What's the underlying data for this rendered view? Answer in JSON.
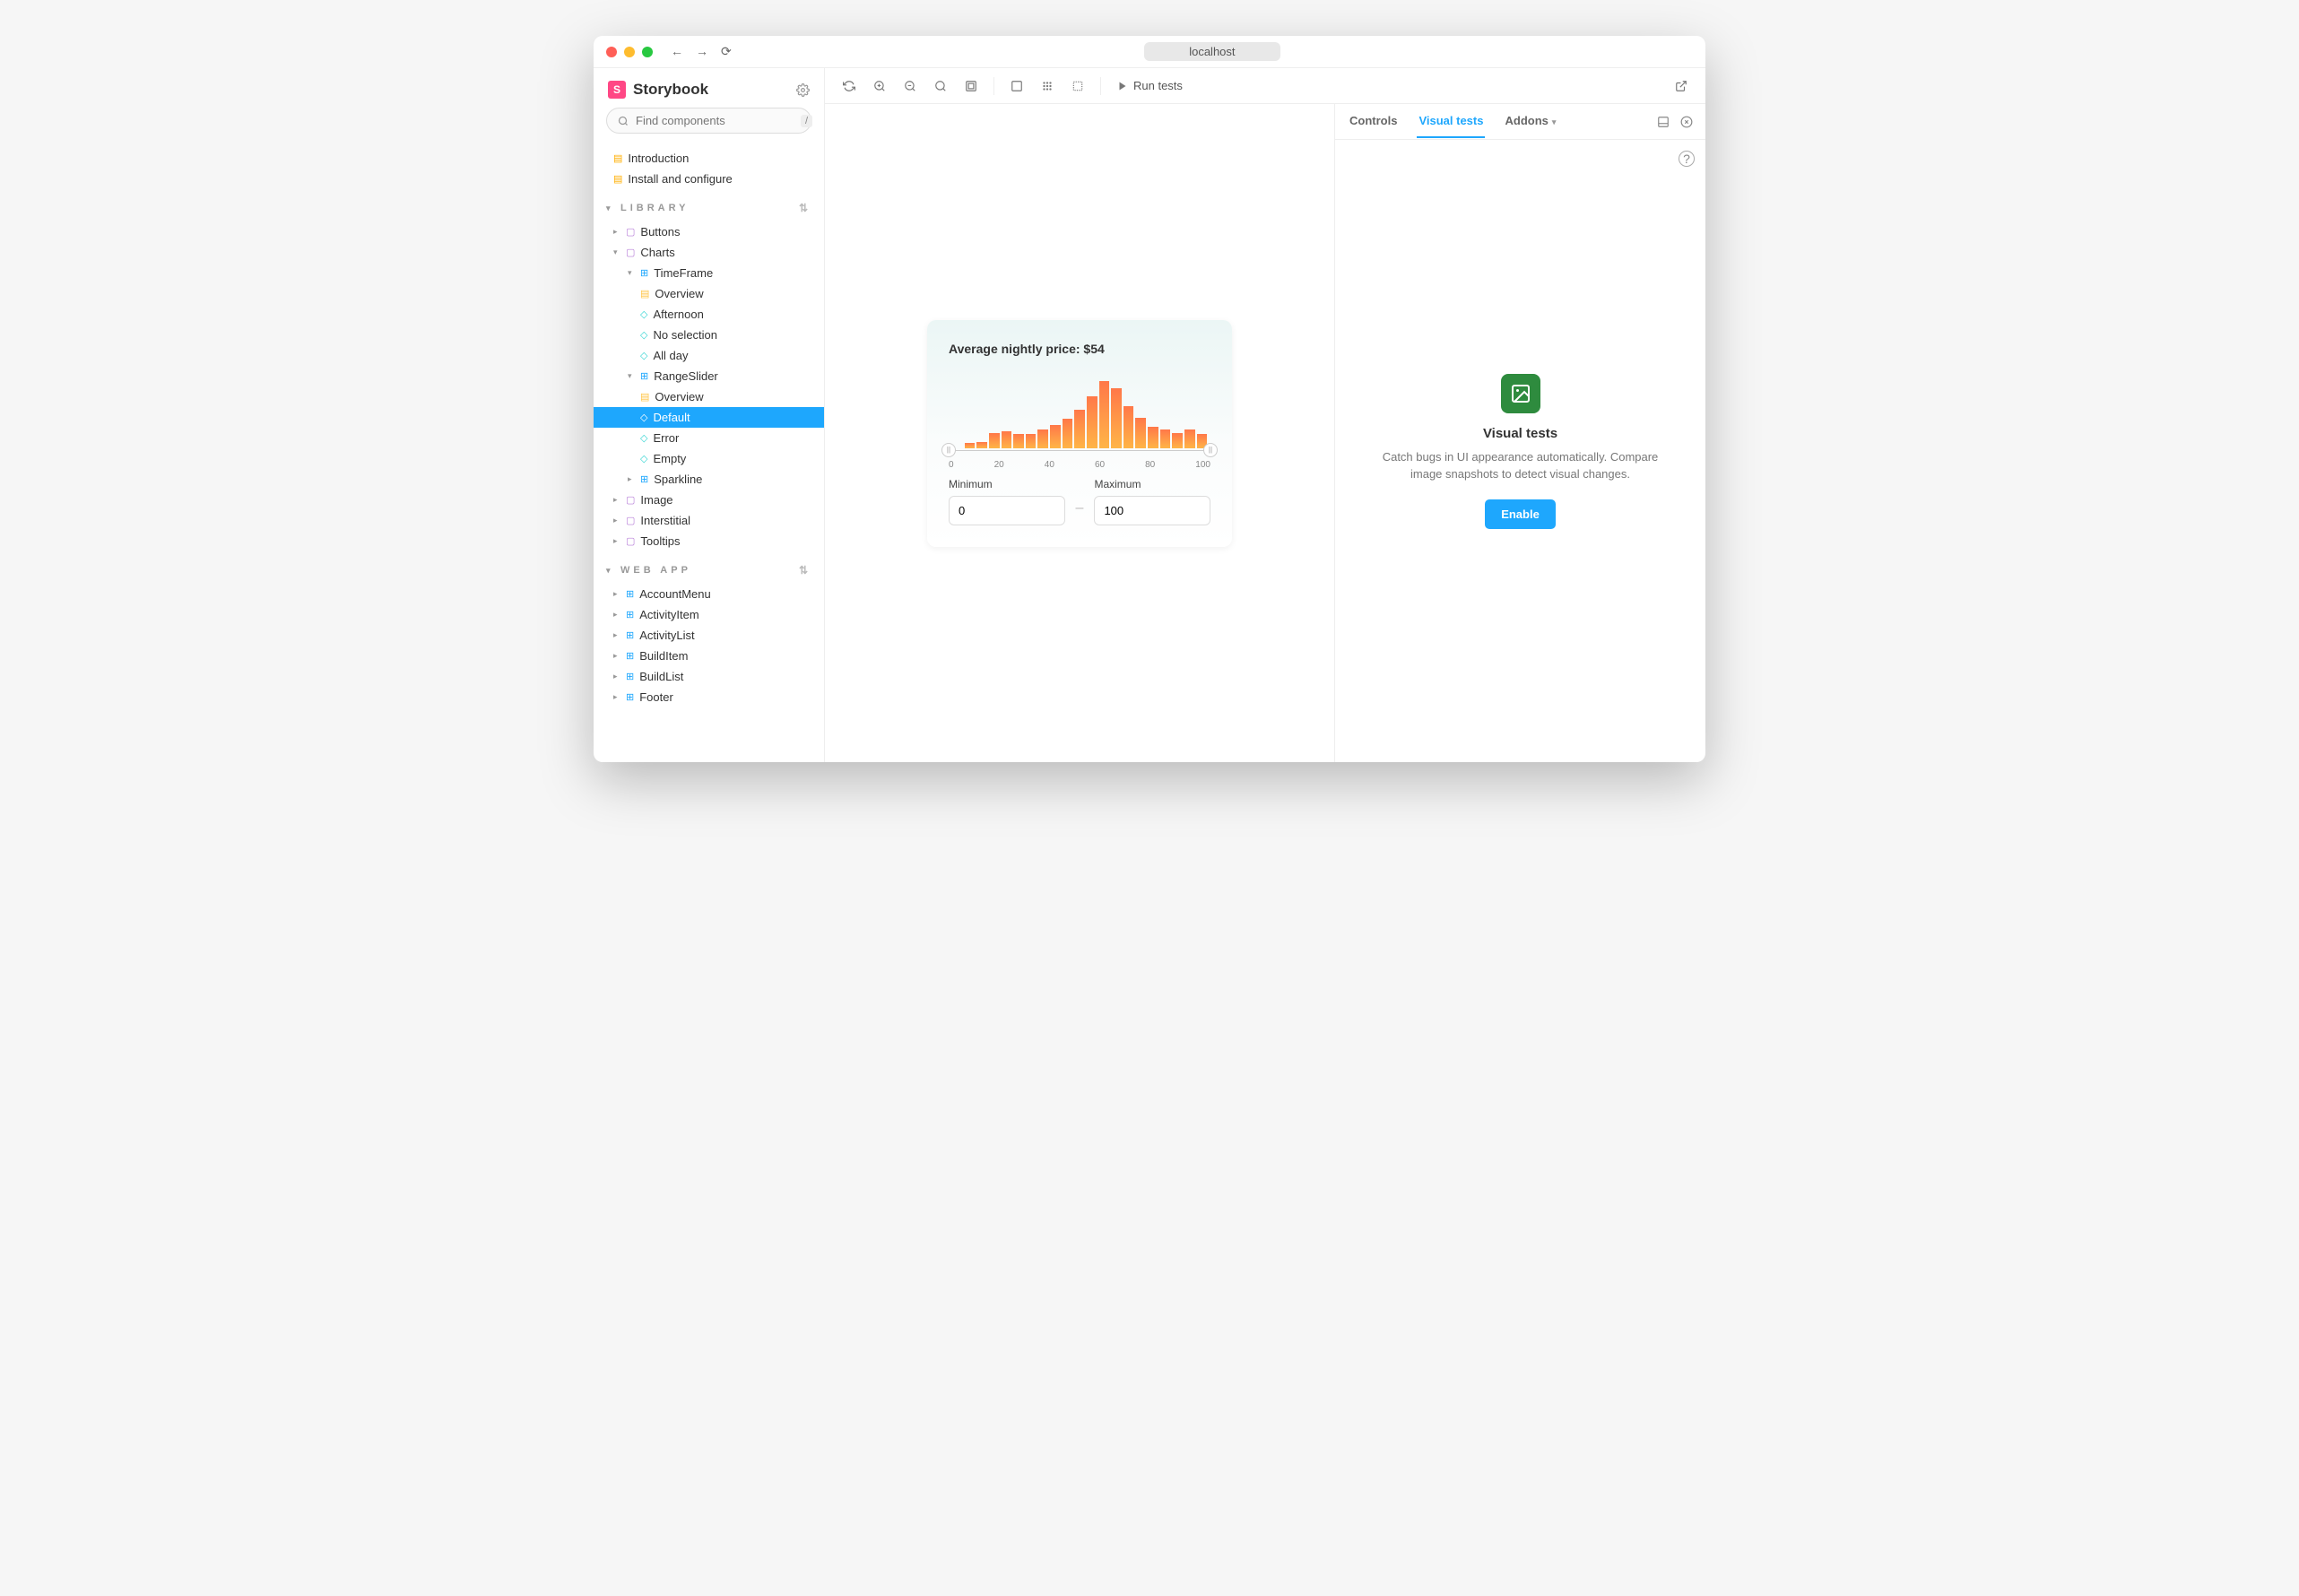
{
  "titlebar": {
    "address": "localhost"
  },
  "sidebar": {
    "brand": "Storybook",
    "search_placeholder": "Find components",
    "slash_key": "/",
    "docs": [
      "Introduction",
      "Install and configure"
    ],
    "sections": {
      "library": {
        "title": "LIBRARY",
        "items": {
          "buttons": "Buttons",
          "charts": "Charts",
          "timeframe": "TimeFrame",
          "tf_overview": "Overview",
          "tf_afternoon": "Afternoon",
          "tf_noselection": "No selection",
          "tf_allday": "All day",
          "rangeslider": "RangeSlider",
          "rs_overview": "Overview",
          "rs_default": "Default",
          "rs_error": "Error",
          "rs_empty": "Empty",
          "sparkline": "Sparkline",
          "image": "Image",
          "interstitial": "Interstitial",
          "tooltips": "Tooltips"
        }
      },
      "webapp": {
        "title": "WEB APP",
        "items": [
          "AccountMenu",
          "ActivityItem",
          "ActivityList",
          "BuildItem",
          "BuildList",
          "Footer"
        ]
      }
    }
  },
  "toolbar": {
    "run_tests": "Run tests"
  },
  "widget": {
    "title": "Average nightly price: $54",
    "min_label": "Minimum",
    "max_label": "Maximum",
    "min_value": "0",
    "max_value": "100"
  },
  "chart_data": {
    "type": "bar",
    "title": "Average nightly price: $54",
    "xlabel": "",
    "ylabel": "",
    "categories": [
      0,
      5,
      10,
      15,
      20,
      25,
      30,
      35,
      40,
      45,
      50,
      55,
      60,
      65,
      70,
      75,
      80,
      85,
      90,
      95,
      100
    ],
    "values": [
      0,
      6,
      8,
      20,
      22,
      18,
      18,
      24,
      30,
      38,
      50,
      68,
      88,
      78,
      55,
      40,
      28,
      24,
      20,
      24,
      18
    ],
    "ticks": [
      "0",
      "20",
      "40",
      "60",
      "80",
      "100"
    ],
    "xlim": [
      0,
      100
    ],
    "ylim": [
      0,
      100
    ]
  },
  "addons": {
    "tabs": {
      "controls": "Controls",
      "visual": "Visual tests",
      "addons": "Addons"
    },
    "visual": {
      "title": "Visual tests",
      "desc": "Catch bugs in UI appearance automatically. Compare image snapshots to detect visual changes.",
      "enable": "Enable"
    }
  }
}
